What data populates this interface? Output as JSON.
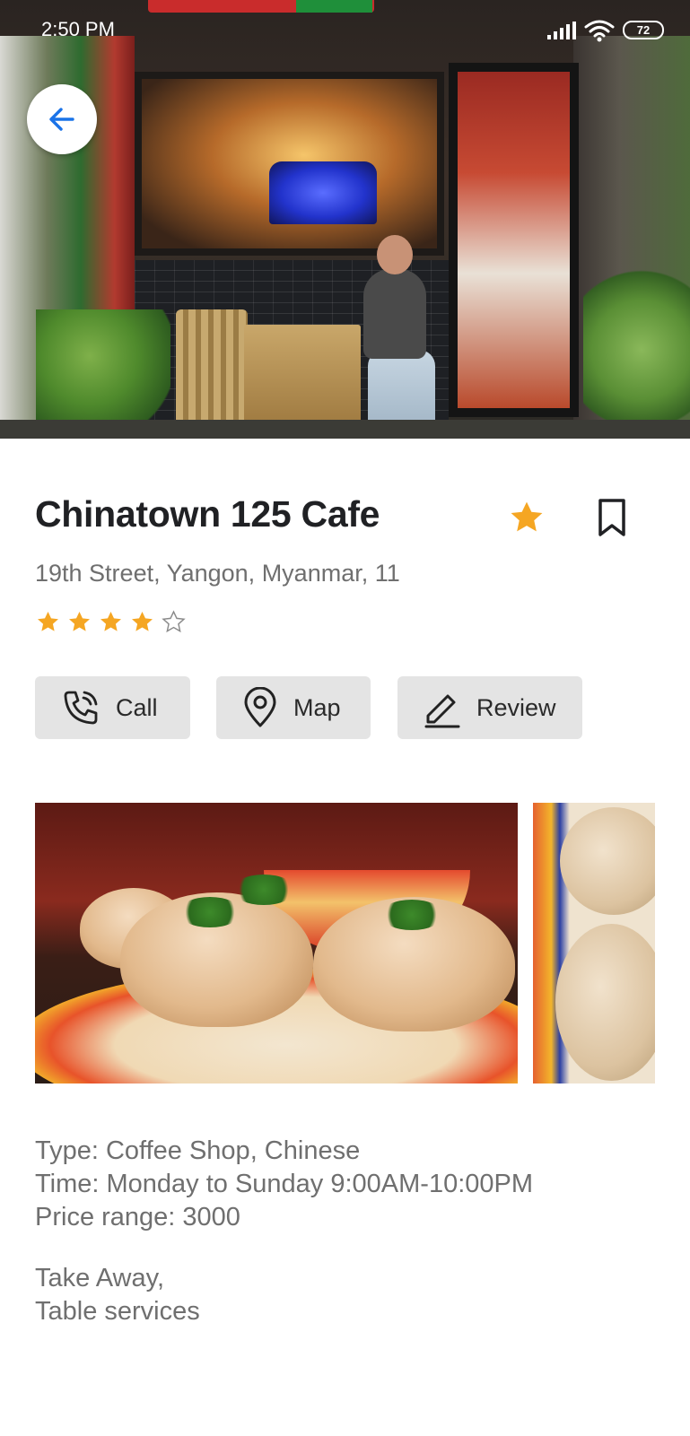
{
  "status_bar": {
    "time": "2:50 PM",
    "battery": "72"
  },
  "hero": {
    "image_alt": "Cafe storefront",
    "back_icon": "arrow-left-icon"
  },
  "place": {
    "name": "Chinatown 125 Cafe",
    "address": "19th Street, Yangon, Myanmar, 11",
    "rating": 4,
    "rating_max": 5,
    "favorite": true
  },
  "actions": [
    {
      "label": "Call",
      "icon": "phone-icon"
    },
    {
      "label": "Map",
      "icon": "location-pin-icon"
    },
    {
      "label": "Review",
      "icon": "pencil-icon"
    }
  ],
  "details": {
    "type": "Type: Coffee Shop, Chinese",
    "time": "Time: Monday to Sunday 9:00AM-10:00PM",
    "price": "Price range: 3000",
    "service_1": "Take Away,",
    "service_2": "Table services"
  },
  "colors": {
    "accent_blue": "#1a73e8",
    "star_orange": "#f5a623",
    "button_bg": "#e4e4e4"
  }
}
